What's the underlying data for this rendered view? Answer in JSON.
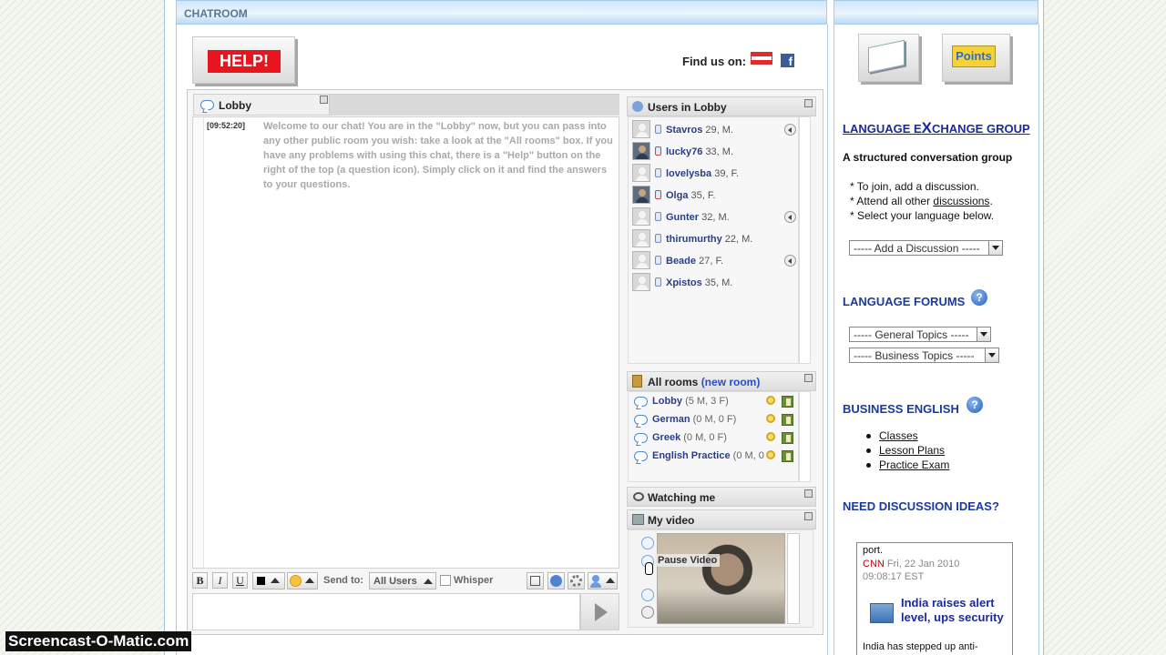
{
  "header": {
    "chatroom_label": "CHATROOM"
  },
  "help": {
    "label": "HELP!"
  },
  "find_us": {
    "label": "Find us on:"
  },
  "chat": {
    "tab_label": "Lobby",
    "message": {
      "time": "[09:52:20]",
      "text": "Welcome to our chat! You are in the \"Lobby\" now, but you can pass into any other public room you wish: take a look at the \"All rooms\" box. If you have any problems with using this chat, there is a \"Help\" button on the right of the top (a question icon). Simply click on it and find the answers to your questions."
    },
    "toolbar": {
      "bold": "B",
      "italic": "I",
      "underline": "U",
      "send_to_label": "Send to:",
      "send_to_value": "All Users",
      "whisper_label": "Whisper"
    }
  },
  "users_panel": {
    "title": "Users in Lobby",
    "users": [
      {
        "name": "Stavros",
        "info": "29, M.",
        "photo": false,
        "play": true,
        "red": false
      },
      {
        "name": "lucky76",
        "info": "33, M.",
        "photo": true,
        "play": false,
        "red": true
      },
      {
        "name": "lovelysba",
        "info": "39, F.",
        "photo": false,
        "play": false,
        "red": false
      },
      {
        "name": "Olga",
        "info": "35, F.",
        "photo": true,
        "play": false,
        "red": true
      },
      {
        "name": "Gunter",
        "info": "32, M.",
        "photo": false,
        "play": true,
        "red": false
      },
      {
        "name": "thirumurthy",
        "info": "22, M.",
        "photo": false,
        "play": false,
        "red": false
      },
      {
        "name": "Beade",
        "info": "27, F.",
        "photo": false,
        "play": true,
        "red": false
      },
      {
        "name": "Xpistos",
        "info": "35, M.",
        "photo": false,
        "play": false,
        "red": false
      }
    ]
  },
  "rooms_panel": {
    "title": "All rooms",
    "new_room": "(new room)",
    "rooms": [
      {
        "name": "Lobby",
        "counts": "(5 M, 3 F)"
      },
      {
        "name": "German",
        "counts": "(0 M, 0 F)"
      },
      {
        "name": "Greek",
        "counts": "(0 M, 0 F)"
      },
      {
        "name": "English Practice",
        "counts": "(0 M, 0"
      }
    ]
  },
  "watching_panel": {
    "title": "Watching me"
  },
  "video_panel": {
    "title": "My video",
    "pause_label": "Pause Video"
  },
  "sidebar": {
    "points_label": "Points",
    "lang_exchange_pre": "LANGUAGE E",
    "lang_exchange_x": "X",
    "lang_exchange_post": "CHANGE GROUP",
    "structured": "A structured conversation group",
    "bullet1": "* To join, add a discussion.",
    "bullet2_pre": "* Attend all other ",
    "bullet2_link": "discussions",
    "bullet2_post": ".",
    "bullet3": "* Select your language below.",
    "add_discussion": "----- Add a Discussion -----",
    "forums_title": "LANGUAGE FORUMS",
    "general_topics": "----- General Topics -----",
    "business_topics": "----- Business Topics -----",
    "business_title": "BUSINESS ENGLISH",
    "business_links": [
      "Classes",
      "Lesson Plans",
      "Practice Exam"
    ],
    "ideas_title": "NEED DISCUSSION IDEAS?",
    "news": {
      "port": "port.",
      "source": "CNN",
      "date": "Fri, 22 Jan 2010",
      "time": "09:08:17 EST",
      "headline": "India raises alert level, ups security",
      "body": "India has stepped up anti-"
    }
  },
  "watermark": "Screencast-O-Matic.com"
}
